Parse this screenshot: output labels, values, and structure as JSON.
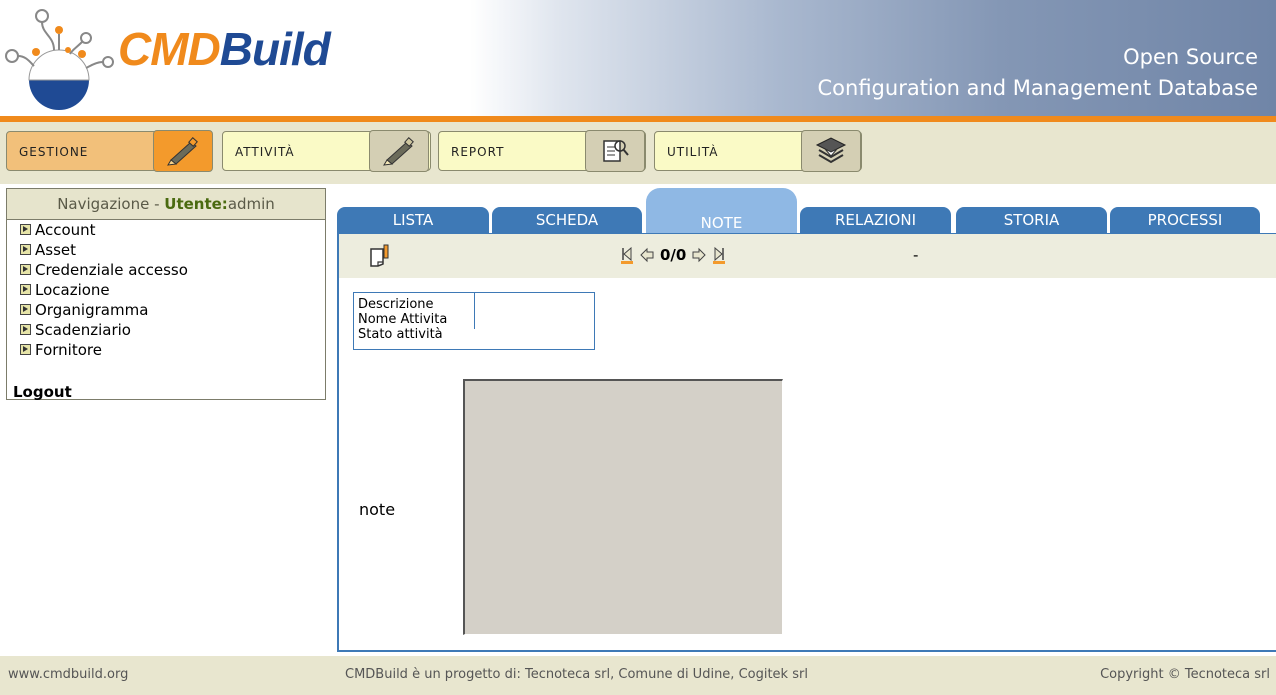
{
  "header": {
    "logo_cmd": "CMD",
    "logo_build": "Build",
    "tagline_1": "Open Source",
    "tagline_2": "Configuration and Management Database"
  },
  "menu": [
    {
      "label": "GESTIONE",
      "icon": "pencil-icon",
      "active": true
    },
    {
      "label": "ATTIVITÀ",
      "icon": "pencil-icon",
      "active": false
    },
    {
      "label": "REPORT",
      "icon": "document-search-icon",
      "active": false
    },
    {
      "label": "UTILITÀ",
      "icon": "stack-icon",
      "active": false
    }
  ],
  "sidebar": {
    "title_prefix": "Navigazione - ",
    "user_label": "Utente:",
    "user_name": "admin",
    "items": [
      {
        "label": "Account"
      },
      {
        "label": "Asset"
      },
      {
        "label": "Credenziale accesso"
      },
      {
        "label": "Locazione"
      },
      {
        "label": "Organigramma"
      },
      {
        "label": "Scadenziario"
      },
      {
        "label": "Fornitore"
      }
    ],
    "logout": "Logout"
  },
  "tabs": [
    {
      "label": "LISTA"
    },
    {
      "label": "SCHEDA"
    },
    {
      "label": "NOTE",
      "active": true
    },
    {
      "label": "RELAZIONI"
    },
    {
      "label": "STORIA"
    },
    {
      "label": "PROCESSI"
    }
  ],
  "toolbar": {
    "counter": "0/0",
    "dash": "-"
  },
  "info_table": {
    "labels": [
      "Descrizione",
      "Nome Attivita",
      "Stato attività"
    ]
  },
  "note": {
    "label": "note",
    "value": ""
  },
  "footer": {
    "left": "www.cmdbuild.org",
    "center": "CMDBuild è un progetto di: Tecnoteca srl, Comune di Udine, Cogitek srl",
    "right": "Copyright © Tecnoteca srl"
  },
  "colors": {
    "accent_orange": "#f08a1c",
    "brand_blue": "#1f4a94",
    "tab_blue": "#3e79b6",
    "tab_active": "#8fb8e4"
  }
}
